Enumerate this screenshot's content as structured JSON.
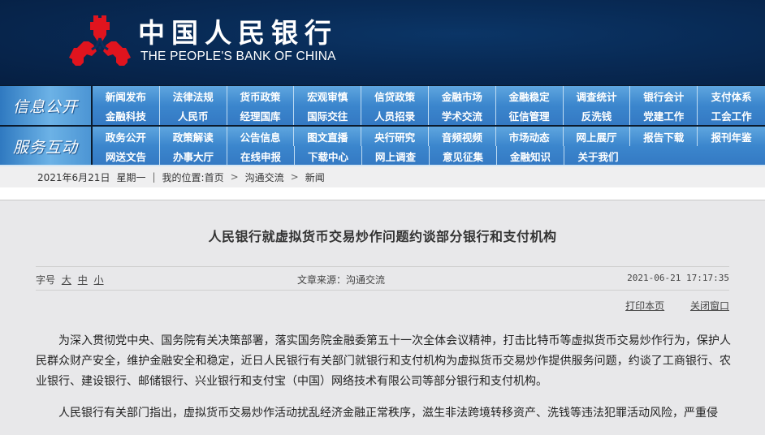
{
  "header": {
    "title_cn": "中国人民银行",
    "title_en": "THE PEOPLE'S BANK OF CHINA",
    "logo_icon": "pboc-logo-icon",
    "brand_red": "#e0141e",
    "banner_color": "#082a55"
  },
  "nav": {
    "groups": [
      {
        "label": "信息公开",
        "rows": [
          [
            "新闻发布",
            "法律法规",
            "货币政策",
            "宏观审慎",
            "信贷政策",
            "金融市场",
            "金融稳定",
            "调查统计",
            "银行会计",
            "支付体系"
          ],
          [
            "金融科技",
            "人民币",
            "经理国库",
            "国际交往",
            "人员招录",
            "学术交流",
            "征信管理",
            "反洗钱",
            "党建工作",
            "工会工作"
          ]
        ]
      },
      {
        "label": "服务互动",
        "rows": [
          [
            "政务公开",
            "政策解读",
            "公告信息",
            "图文直播",
            "央行研究",
            "音频视频",
            "市场动态",
            "网上展厅",
            "报告下载",
            "报刊年鉴"
          ],
          [
            "网送文告",
            "办事大厅",
            "在线申报",
            "下载中心",
            "网上调查",
            "意见征集",
            "金融知识",
            "关于我们"
          ]
        ]
      }
    ]
  },
  "breadcrumb": {
    "date": "2021年6月21日",
    "weekday": "星期一",
    "divider": "|",
    "location_label": "我的位置:",
    "items": [
      "首页",
      "沟通交流",
      "新闻"
    ],
    "separator": ">"
  },
  "article": {
    "title": "人民银行就虚拟货币交易炒作问题约谈部分银行和支付机构",
    "font_size_label": "字号",
    "font_sizes": [
      "大",
      "中",
      "小"
    ],
    "source": "文章来源：沟通交流",
    "datetime": "2021-06-21 17:17:35",
    "print_label": "打印本页",
    "close_label": "关闭窗口",
    "paragraphs": [
      "为深入贯彻党中央、国务院有关决策部署，落实国务院金融委第五十一次全体会议精神，打击比特币等虚拟货币交易炒作行为，保护人民群众财产安全，维护金融安全和稳定，近日人民银行有关部门就银行和支付机构为虚拟货币交易炒作提供服务问题，约谈了工商银行、农业银行、建设银行、邮储银行、兴业银行和支付宝（中国）网络技术有限公司等部分银行和支付机构。",
      "人民银行有关部门指出，虚拟货币交易炒作活动扰乱经济金融正常秩序，滋生非法跨境转移资产、洗钱等违法犯罪活动风险，严重侵"
    ]
  }
}
